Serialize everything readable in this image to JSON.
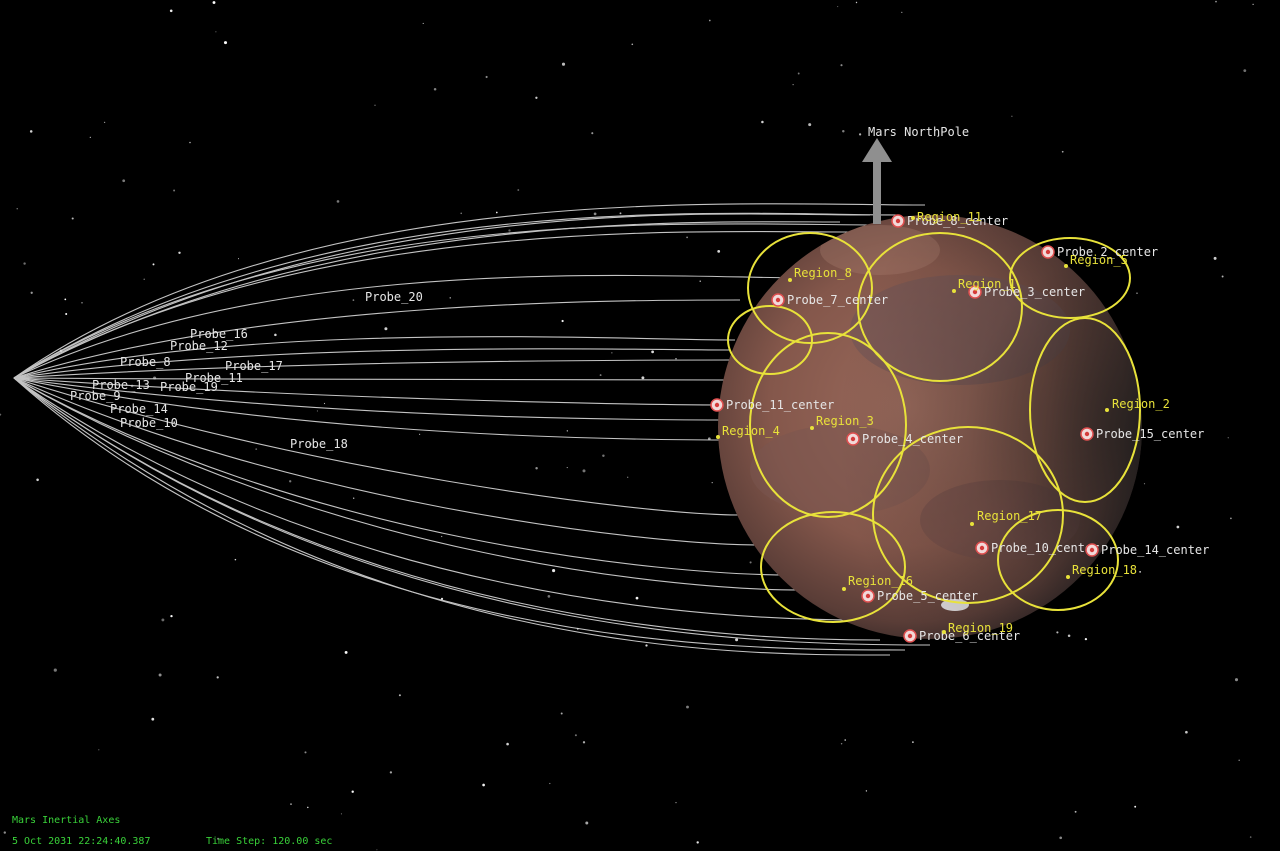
{
  "view": {
    "north_pole_label": "Mars NorthPole",
    "axes_label": "Mars Inertial Axes",
    "date_time": "5 Oct 2031 22:24:40.387",
    "time_step": "Time Step: 120.00 sec"
  },
  "colors": {
    "background": "#000000",
    "planet": "#8a5a4e",
    "region_outline": "#e8e23a",
    "trajectory": "#d9d9d9",
    "hud_text": "#39d139"
  },
  "probe_labels": [
    "Probe_20",
    "Probe_16",
    "Probe_12",
    "Probe_8",
    "Probe_17",
    "Probe_11",
    "Probe_13",
    "Probe_19",
    "Probe_9",
    "Probe_14",
    "Probe_10",
    "Probe_18"
  ],
  "probe_centers": [
    "Probe_2_center",
    "Probe_7_center",
    "Probe_3_center",
    "Probe_11_center",
    "Probe_4_center",
    "Probe_15_center",
    "Probe_10_center",
    "Probe_14_center",
    "Probe_5_center",
    "Probe_8_center",
    "Probe_6_center"
  ],
  "regions": [
    "Region_11",
    "Region_5",
    "Region_8",
    "Region_1",
    "Region_2",
    "Region_3",
    "Region_4",
    "Region_17",
    "Region_18",
    "Region_16",
    "Region_19"
  ]
}
